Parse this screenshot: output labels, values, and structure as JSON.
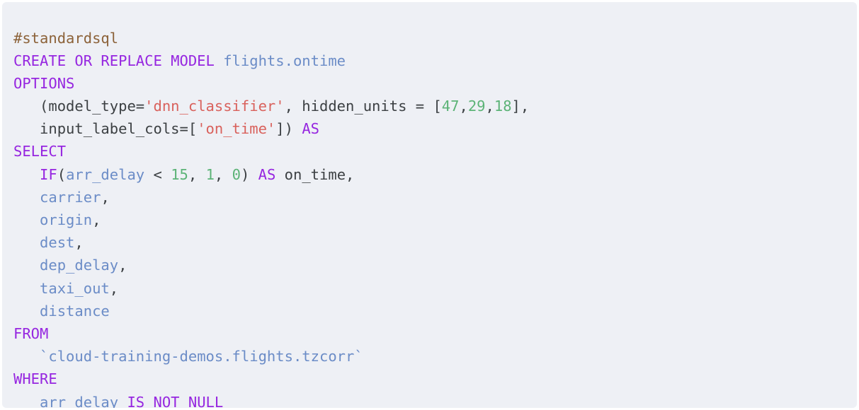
{
  "panel": {
    "name": "sql-code-snippet",
    "background_color": "#eef0f5",
    "outer_background_color": "#ffffff"
  },
  "syntax_colors": {
    "comment": "#8c6239",
    "keyword": "#9626e0",
    "identifier": "#6b8cc7",
    "string": "#d9615c",
    "number": "#5cb377",
    "plain": "#3c4043"
  },
  "code": {
    "language": "sql",
    "full_text": "#standardsql\nCREATE OR REPLACE MODEL flights.ontime\nOPTIONS\n   (model_type='dnn_classifier', hidden_units = [47,29,18],\n   input_label_cols=['on_time']) AS\nSELECT\n   IF(arr_delay < 15, 1, 0) AS on_time,\n   carrier,\n   origin,\n   dest,\n   dep_delay,\n   taxi_out,\n   distance\nFROM\n   `cloud-training-demos.flights.tzcorr`\nWHERE\n   arr_delay IS NOT NULL",
    "lines": [
      {
        "index": 1,
        "text": "#standardsql",
        "tokens": [
          {
            "t": "#standardsql",
            "c": "comment"
          }
        ]
      },
      {
        "index": 2,
        "text": "CREATE OR REPLACE MODEL flights.ontime",
        "tokens": [
          {
            "t": "CREATE OR REPLACE MODEL",
            "c": "keyword"
          },
          {
            "t": " ",
            "c": "plain"
          },
          {
            "t": "flights.ontime",
            "c": "identifier"
          }
        ]
      },
      {
        "index": 3,
        "text": "OPTIONS",
        "tokens": [
          {
            "t": "OPTIONS",
            "c": "keyword"
          }
        ]
      },
      {
        "index": 4,
        "text": "   (model_type='dnn_classifier', hidden_units = [47,29,18],",
        "tokens": [
          {
            "t": "   (model_type=",
            "c": "plain"
          },
          {
            "t": "'dnn_classifier'",
            "c": "string"
          },
          {
            "t": ", hidden_units = [",
            "c": "plain"
          },
          {
            "t": "47",
            "c": "number"
          },
          {
            "t": ",",
            "c": "plain"
          },
          {
            "t": "29",
            "c": "number"
          },
          {
            "t": ",",
            "c": "plain"
          },
          {
            "t": "18",
            "c": "number"
          },
          {
            "t": "],",
            "c": "plain"
          }
        ]
      },
      {
        "index": 5,
        "text": "   input_label_cols=['on_time']) AS",
        "tokens": [
          {
            "t": "   input_label_cols=[",
            "c": "plain"
          },
          {
            "t": "'on_time'",
            "c": "string"
          },
          {
            "t": "]) ",
            "c": "plain"
          },
          {
            "t": "AS",
            "c": "keyword"
          }
        ]
      },
      {
        "index": 6,
        "text": "SELECT",
        "tokens": [
          {
            "t": "SELECT",
            "c": "keyword"
          }
        ]
      },
      {
        "index": 7,
        "text": "   IF(arr_delay < 15, 1, 0) AS on_time,",
        "tokens": [
          {
            "t": "   ",
            "c": "plain"
          },
          {
            "t": "IF",
            "c": "keyword"
          },
          {
            "t": "(",
            "c": "plain"
          },
          {
            "t": "arr_delay",
            "c": "identifier"
          },
          {
            "t": " < ",
            "c": "plain"
          },
          {
            "t": "15",
            "c": "number"
          },
          {
            "t": ", ",
            "c": "plain"
          },
          {
            "t": "1",
            "c": "number"
          },
          {
            "t": ", ",
            "c": "plain"
          },
          {
            "t": "0",
            "c": "number"
          },
          {
            "t": ") ",
            "c": "plain"
          },
          {
            "t": "AS",
            "c": "keyword"
          },
          {
            "t": " on_time,",
            "c": "plain"
          }
        ]
      },
      {
        "index": 8,
        "text": "   carrier,",
        "tokens": [
          {
            "t": "   ",
            "c": "plain"
          },
          {
            "t": "carrier",
            "c": "identifier"
          },
          {
            "t": ",",
            "c": "plain"
          }
        ]
      },
      {
        "index": 9,
        "text": "   origin,",
        "tokens": [
          {
            "t": "   ",
            "c": "plain"
          },
          {
            "t": "origin",
            "c": "identifier"
          },
          {
            "t": ",",
            "c": "plain"
          }
        ]
      },
      {
        "index": 10,
        "text": "   dest,",
        "tokens": [
          {
            "t": "   ",
            "c": "plain"
          },
          {
            "t": "dest",
            "c": "identifier"
          },
          {
            "t": ",",
            "c": "plain"
          }
        ]
      },
      {
        "index": 11,
        "text": "   dep_delay,",
        "tokens": [
          {
            "t": "   ",
            "c": "plain"
          },
          {
            "t": "dep_delay",
            "c": "identifier"
          },
          {
            "t": ",",
            "c": "plain"
          }
        ]
      },
      {
        "index": 12,
        "text": "   taxi_out,",
        "tokens": [
          {
            "t": "   ",
            "c": "plain"
          },
          {
            "t": "taxi_out",
            "c": "identifier"
          },
          {
            "t": ",",
            "c": "plain"
          }
        ]
      },
      {
        "index": 13,
        "text": "   distance",
        "tokens": [
          {
            "t": "   ",
            "c": "plain"
          },
          {
            "t": "distance",
            "c": "identifier"
          }
        ]
      },
      {
        "index": 14,
        "text": "FROM",
        "tokens": [
          {
            "t": "FROM",
            "c": "keyword"
          }
        ]
      },
      {
        "index": 15,
        "text": "   `cloud-training-demos.flights.tzcorr`",
        "tokens": [
          {
            "t": "   ",
            "c": "plain"
          },
          {
            "t": "`cloud-training-demos.flights.tzcorr`",
            "c": "identifier"
          }
        ]
      },
      {
        "index": 16,
        "text": "WHERE",
        "tokens": [
          {
            "t": "WHERE",
            "c": "keyword"
          }
        ]
      },
      {
        "index": 17,
        "text": "   arr_delay IS NOT NULL",
        "tokens": [
          {
            "t": "   ",
            "c": "plain"
          },
          {
            "t": "arr_delay",
            "c": "identifier"
          },
          {
            "t": " ",
            "c": "plain"
          },
          {
            "t": "IS NOT NULL",
            "c": "keyword"
          }
        ]
      }
    ]
  }
}
